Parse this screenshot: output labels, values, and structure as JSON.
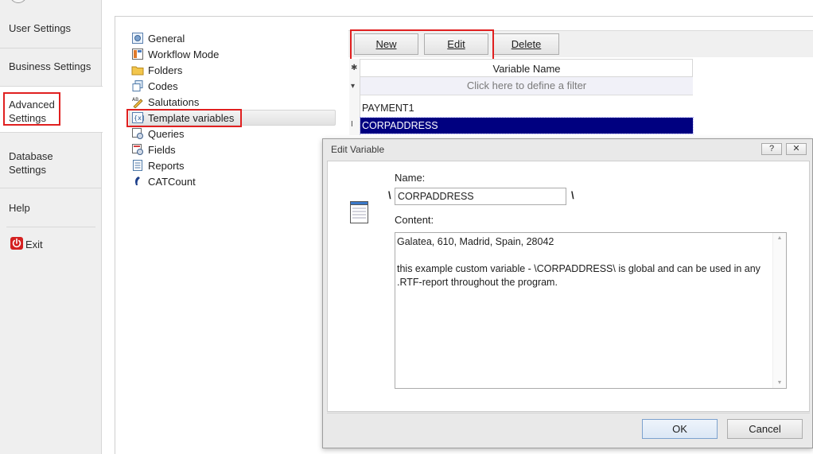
{
  "sidebar": {
    "items": [
      {
        "label": "User Settings"
      },
      {
        "label": "Business Settings"
      },
      {
        "label": "Advanced Settings"
      },
      {
        "label": "Database Settings"
      },
      {
        "label": "Help"
      },
      {
        "label": "Exit"
      }
    ],
    "selected": "Advanced Settings"
  },
  "tree": {
    "items": [
      {
        "label": "General",
        "icon": "general-icon"
      },
      {
        "label": "Workflow Mode",
        "icon": "workflow-icon"
      },
      {
        "label": "Folders",
        "icon": "folder-icon"
      },
      {
        "label": "Codes",
        "icon": "codes-icon"
      },
      {
        "label": "Salutations",
        "icon": "salutations-icon"
      },
      {
        "label": "Template variables",
        "icon": "template-variables-icon"
      },
      {
        "label": "Queries",
        "icon": "queries-icon"
      },
      {
        "label": "Fields",
        "icon": "fields-icon"
      },
      {
        "label": "Reports",
        "icon": "reports-icon"
      },
      {
        "label": "CATCount",
        "icon": "catcount-icon"
      }
    ],
    "selected": "Template variables"
  },
  "toolbar": {
    "new_label": "New",
    "edit_label": "Edit",
    "delete_label": "Delete"
  },
  "grid": {
    "column_header": "Variable Name",
    "filter_placeholder": "Click here to define a filter",
    "rows": [
      "PAYMENT1",
      "CORPADDRESS"
    ],
    "selected_row": "CORPADDRESS"
  },
  "dialog": {
    "title": "Edit Variable",
    "help_button": "?",
    "close_button": "✕",
    "name_label": "Name:",
    "name_value": "CORPADDRESS",
    "slash_left": "\\",
    "slash_right": "\\",
    "content_label": "Content:",
    "content_value": "Galatea, 610, Madrid, Spain, 28042\n\nthis example custom variable - \\CORPADDRESS\\ is global and can be used in any .RTF-report throughout the program.",
    "ok_label": "OK",
    "cancel_label": "Cancel"
  },
  "colors": {
    "highlight_border": "#e02020",
    "selection_background": "#000080"
  }
}
